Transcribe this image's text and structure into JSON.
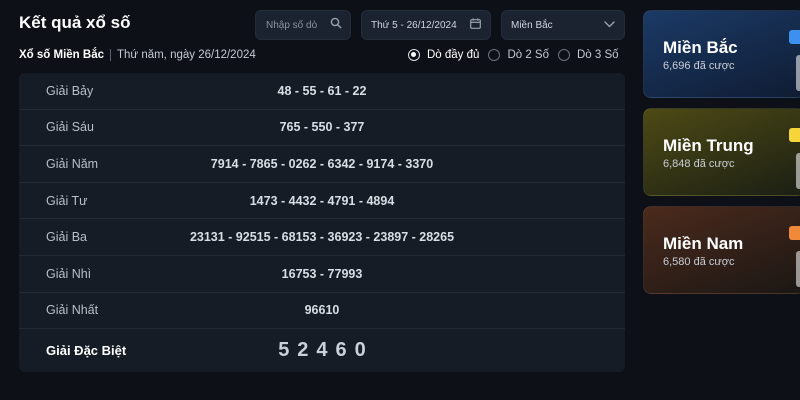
{
  "header": {
    "title": "Kết quả xổ số",
    "search_placeholder": "Nhập số dò",
    "date_value": "Thứ 5 - 26/12/2024",
    "region_selected": "Miền Bắc"
  },
  "subheader": {
    "region": "Xổ số Miền Bắc",
    "date_text": "Thứ năm, ngày 26/12/2024"
  },
  "options": [
    {
      "label": "Dò đầy đủ",
      "selected": true
    },
    {
      "label": "Dò 2 Số",
      "selected": false
    },
    {
      "label": "Dò 3 Số",
      "selected": false
    }
  ],
  "results": [
    {
      "label": "Giải Bảy",
      "numbers": "48 - 55 - 61 - 22"
    },
    {
      "label": "Giải Sáu",
      "numbers": "765 - 550 - 377"
    },
    {
      "label": "Giải Năm",
      "numbers": "7914 - 7865 - 0262 - 6342 - 9174 - 3370"
    },
    {
      "label": "Giải Tư",
      "numbers": "1473 - 4432 - 4791 - 4894"
    },
    {
      "label": "Giải Ba",
      "numbers": "23131 - 92515 - 68153 - 36923 - 23897 - 28265"
    },
    {
      "label": "Giải Nhì",
      "numbers": "16753 - 77993"
    },
    {
      "label": "Giải Nhất",
      "numbers": "96610"
    },
    {
      "label": "Giải Đặc Biệt",
      "numbers": "52460"
    }
  ],
  "regions": [
    {
      "name": "Miền Bắc",
      "count": "6,696 đã cược",
      "tag_color": "#3d8ff0"
    },
    {
      "name": "Miền Trung",
      "count": "6,848 đã cược",
      "tag_color": "#f5d53a"
    },
    {
      "name": "Miền Nam",
      "count": "6,580 đã cược",
      "tag_color": "#f08a3a"
    }
  ],
  "icons": {
    "search": "search-icon",
    "calendar": "calendar-icon",
    "dropdown": "chevron-down-icon"
  }
}
